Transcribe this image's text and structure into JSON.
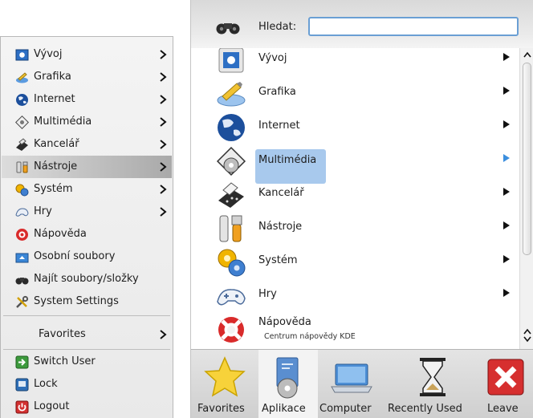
{
  "classic_menu": {
    "items": [
      {
        "label": "Vývoj",
        "icon": "development-icon",
        "has_submenu": true
      },
      {
        "label": "Grafika",
        "icon": "graphics-icon",
        "has_submenu": true
      },
      {
        "label": "Internet",
        "icon": "internet-globe-icon",
        "has_submenu": true
      },
      {
        "label": "Multimédia",
        "icon": "multimedia-icon",
        "has_submenu": true
      },
      {
        "label": "Kancelář",
        "icon": "office-icon",
        "has_submenu": true
      },
      {
        "label": "Nástroje",
        "icon": "tools-icon",
        "has_submenu": true,
        "selected": true
      },
      {
        "label": "Systém",
        "icon": "system-icon",
        "has_submenu": true
      },
      {
        "label": "Hry",
        "icon": "games-icon",
        "has_submenu": true
      },
      {
        "label": "Nápověda",
        "icon": "help-icon",
        "has_submenu": false
      },
      {
        "label": "Osobní soubory",
        "icon": "home-folder-icon",
        "has_submenu": false
      },
      {
        "label": "Najít soubory/složky",
        "icon": "binoculars-icon",
        "has_submenu": false
      },
      {
        "label": "System Settings",
        "icon": "settings-icon",
        "has_submenu": false
      }
    ],
    "favorites_label": "Favorites",
    "session": [
      {
        "label": "Switch User",
        "icon": "switch-user-icon"
      },
      {
        "label": "Lock",
        "icon": "lock-icon"
      },
      {
        "label": "Logout",
        "icon": "logout-icon"
      }
    ]
  },
  "kickoff": {
    "search_label": "Hledat:",
    "search_value": "",
    "items": [
      {
        "label": "Vývoj",
        "icon": "development-icon",
        "has_submenu": true
      },
      {
        "label": "Grafika",
        "icon": "graphics-icon",
        "has_submenu": true
      },
      {
        "label": "Internet",
        "icon": "internet-globe-icon",
        "has_submenu": true
      },
      {
        "label": "Multimédia",
        "icon": "multimedia-icon",
        "has_submenu": true,
        "selected": true
      },
      {
        "label": "Kancelář",
        "icon": "office-icon",
        "has_submenu": true
      },
      {
        "label": "Nástroje",
        "icon": "tools-icon",
        "has_submenu": true
      },
      {
        "label": "Systém",
        "icon": "system-icon",
        "has_submenu": true
      },
      {
        "label": "Hry",
        "icon": "games-icon",
        "has_submenu": true
      },
      {
        "label": "Nápověda",
        "subtitle": "Centrum nápovědy KDE",
        "icon": "help-icon",
        "has_submenu": false
      }
    ],
    "tabs": [
      {
        "label": "Favorites",
        "icon": "star-icon"
      },
      {
        "label": "Aplikace",
        "icon": "applications-icon",
        "active": true
      },
      {
        "label": "Computer",
        "icon": "computer-icon"
      },
      {
        "label": "Recently Used",
        "icon": "hourglass-icon"
      },
      {
        "label": "Leave",
        "icon": "leave-icon"
      }
    ]
  },
  "colors": {
    "selection_blue": "#a8c9ed",
    "arrow_blue": "#3c8fde",
    "search_border": "#6a9fd4"
  }
}
